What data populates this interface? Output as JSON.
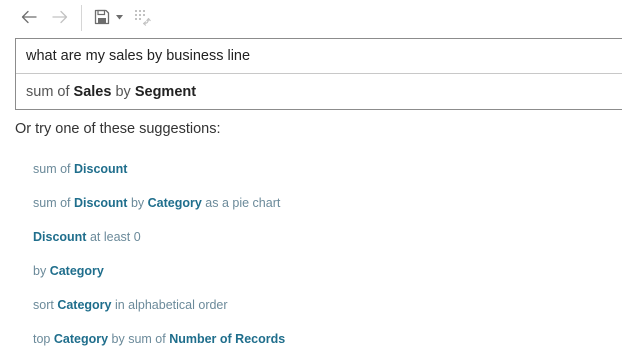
{
  "toolbar": {
    "back_icon": "arrow-left-icon",
    "forward_icon": "arrow-right-icon",
    "save_icon": "floppy-disk-icon",
    "dropdown_icon": "caret-down-icon",
    "swap_icon": "swap-axes-icon"
  },
  "query": {
    "value": "what are my sales by business line"
  },
  "interpretation": {
    "p0": "sum of ",
    "f0": "Sales",
    "p1": " by ",
    "f1": "Segment"
  },
  "suggestions": {
    "heading": "Or try one of these suggestions:",
    "items": [
      {
        "p0": "sum of ",
        "f0": "Discount"
      },
      {
        "p0": "sum of ",
        "f0": "Discount",
        "p1": " by ",
        "f1": "Category",
        "p2": " as a pie chart"
      },
      {
        "f0": "Discount",
        "p1": " at least 0"
      },
      {
        "p0": "by ",
        "f0": "Category"
      },
      {
        "p0": "sort ",
        "f0": "Category",
        "p1": " in alphabetical order"
      },
      {
        "p0": "top ",
        "f0": "Category",
        "p1": " by sum of ",
        "f1": "Number of Records"
      }
    ]
  },
  "colors": {
    "field_text": "#1f6e8c",
    "plain_suggestion_text": "#6b8a9a",
    "icon_active": "#6d6d6d",
    "icon_disabled": "#c2c2c2"
  }
}
